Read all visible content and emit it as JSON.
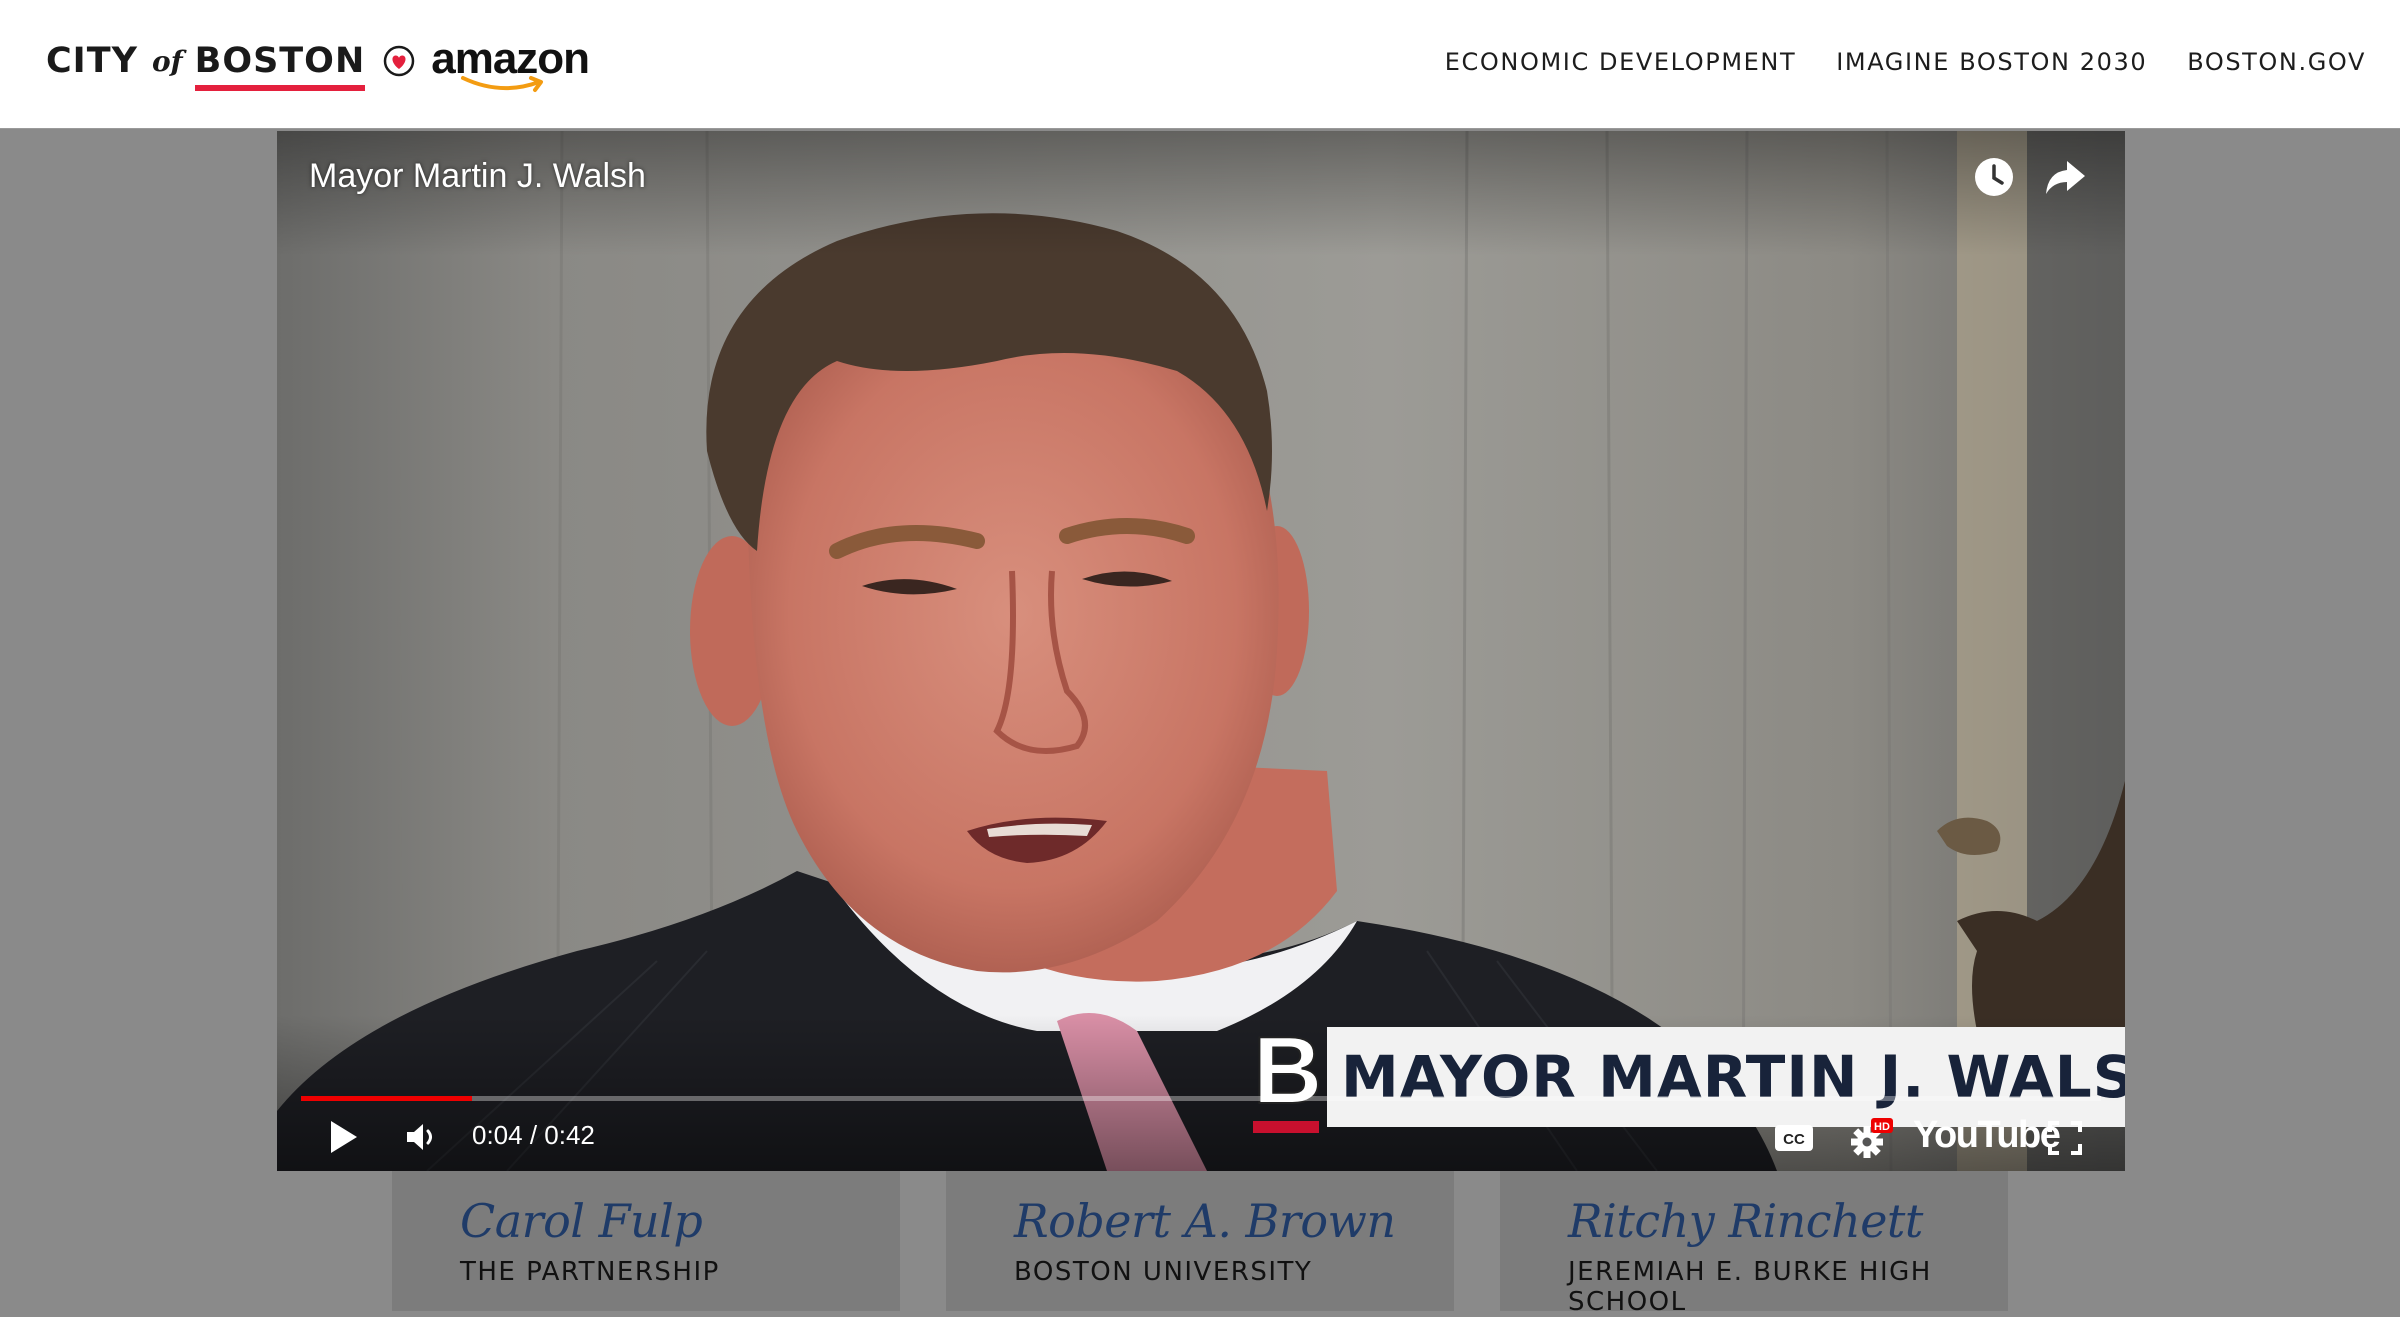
{
  "header": {
    "logo": {
      "city": "CITY",
      "of": "of",
      "boston": "BOSTON",
      "partner": "amazon",
      "icon": "heart-icon"
    },
    "nav": [
      {
        "label": "ECONOMIC DEVELOPMENT"
      },
      {
        "label": "IMAGINE BOSTON 2030"
      },
      {
        "label": "BOSTON.GOV"
      }
    ]
  },
  "video": {
    "title": "Mayor Martin J. Walsh",
    "lower_third": {
      "logo_letter": "B",
      "name": "MAYOR MARTIN J. WALSH"
    },
    "current_time": "0:04",
    "duration": "0:42",
    "time_display": "0:04 / 0:42",
    "progress": 0.0952,
    "brand": "YouTube",
    "icons": [
      "watch-later-icon",
      "share-icon",
      "play-icon",
      "volume-icon",
      "cc-icon",
      "settings-icon",
      "fullscreen-icon"
    ],
    "settings_badge": "HD",
    "cc_label": "CC"
  },
  "cards": [
    {
      "name": "Carol Fulp",
      "org": "THE PARTNERSHIP"
    },
    {
      "name": "Robert A. Brown",
      "org": "BOSTON UNIVERSITY"
    },
    {
      "name": "Ritchy Rinchett",
      "org": "JEREMIAH E. BURKE HIGH SCHOOL"
    }
  ],
  "colors": {
    "accent_red": "#e4203d",
    "navy": "#18233a",
    "card_name": "#1f3b68",
    "overlay_gray": "#8a8a8a",
    "progress_red": "#ee0000"
  }
}
